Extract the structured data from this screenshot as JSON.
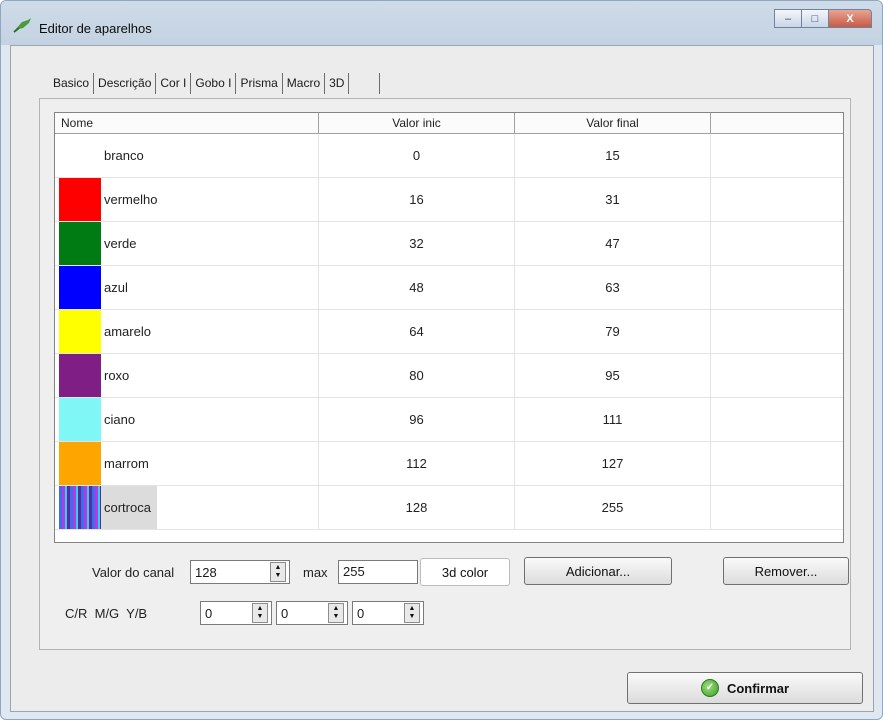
{
  "window": {
    "title": "Editor de aparelhos",
    "min_icon": "–",
    "max_icon": "□",
    "close_icon": "X"
  },
  "tabs": [
    {
      "label": "Basico"
    },
    {
      "label": "Descrição"
    },
    {
      "label": "Cor I",
      "active": true
    },
    {
      "label": "Gobo I"
    },
    {
      "label": "Prisma"
    },
    {
      "label": "Macro"
    },
    {
      "label": "3D"
    }
  ],
  "grid": {
    "columns": [
      "Nome",
      "Valor inic",
      "Valor final",
      ""
    ],
    "rows": [
      {
        "name": "branco",
        "start": "0",
        "end": "15",
        "color": ""
      },
      {
        "name": "vermelho",
        "start": "16",
        "end": "31",
        "color": "#ff0000"
      },
      {
        "name": "verde",
        "start": "32",
        "end": "47",
        "color": "#007a12"
      },
      {
        "name": "azul",
        "start": "48",
        "end": "63",
        "color": "#0000ff"
      },
      {
        "name": "amarelo",
        "start": "64",
        "end": "79",
        "color": "#ffff00"
      },
      {
        "name": "roxo",
        "start": "80",
        "end": "95",
        "color": "#7f1f86"
      },
      {
        "name": "ciano",
        "start": "96",
        "end": "111",
        "color": "#7ff7f7"
      },
      {
        "name": "marrom",
        "start": "112",
        "end": "127",
        "color": "#ffa500"
      },
      {
        "name": "cortroca",
        "start": "128",
        "end": "255",
        "color": "rainbow",
        "selected": true
      }
    ]
  },
  "controls": {
    "channel_label": "Valor do canal",
    "channel_value": "128",
    "max_label": "max",
    "max_value": "255",
    "btn_3d_color": "3d color",
    "btn_add": "Adicionar...",
    "btn_remove": "Remover...",
    "cmy_label": "C/R  M/G  Y/B",
    "cmy_c": "0",
    "cmy_m": "0",
    "cmy_y": "0"
  },
  "footer": {
    "confirm": "Confirmar"
  }
}
